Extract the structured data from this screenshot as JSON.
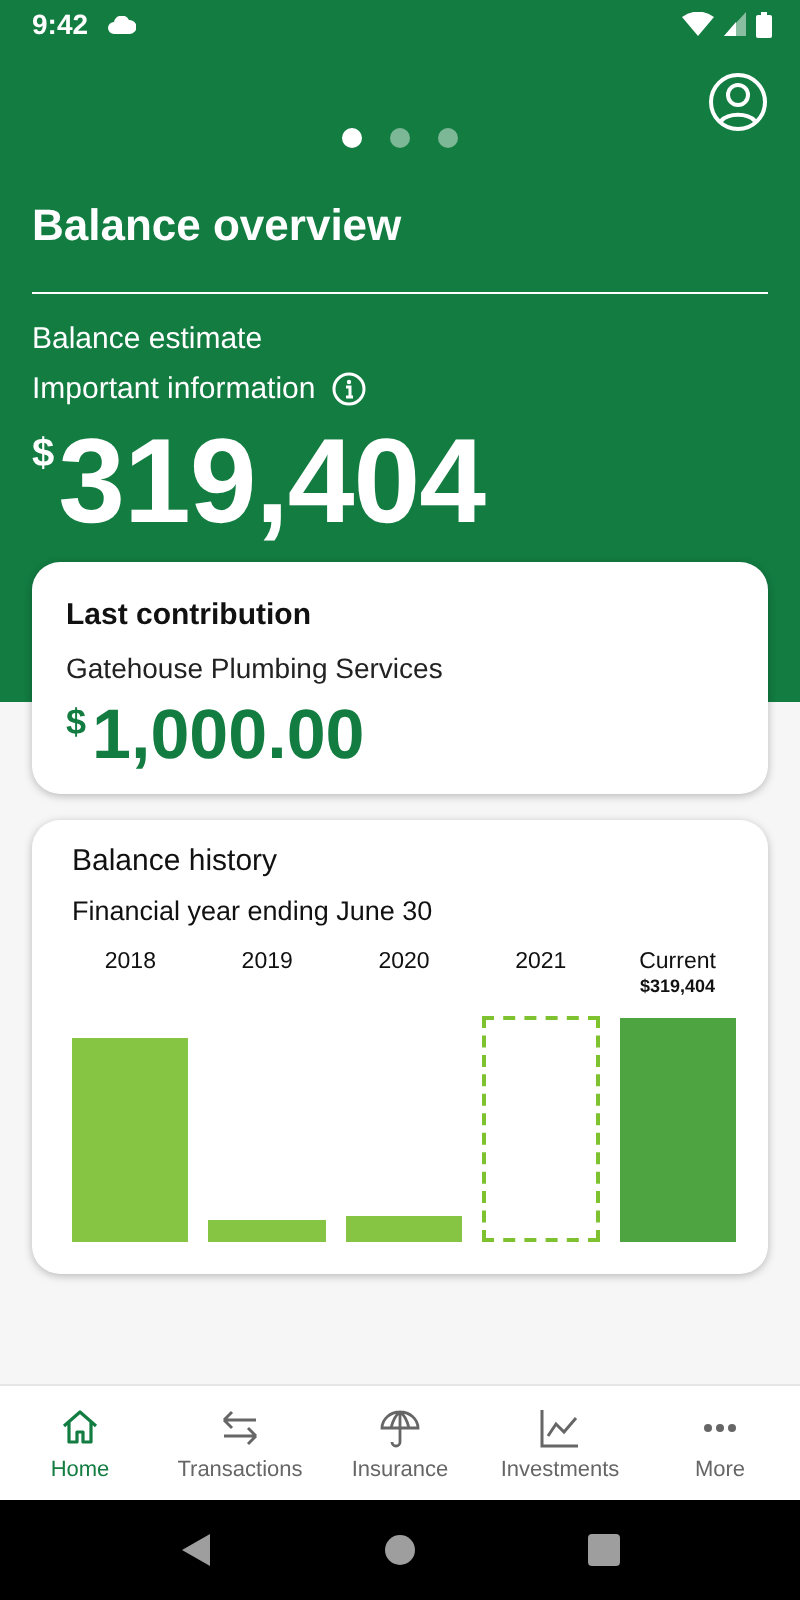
{
  "status_bar": {
    "time": "9:42"
  },
  "carousel": {
    "pages": [
      {
        "selected": true
      },
      {
        "selected": false
      },
      {
        "selected": false
      }
    ]
  },
  "header": {
    "title": "Balance overview",
    "subtitle": "Balance estimate",
    "info_link": "Important information",
    "currency": "$",
    "amount": "319,404"
  },
  "last_contribution": {
    "title": "Last contribution",
    "payer": "Gatehouse Plumbing Services",
    "currency": "$",
    "amount": "1,000.00"
  },
  "balance_history": {
    "title": "Balance history",
    "subtitle": "Financial year ending June 30",
    "bars": [
      {
        "label": "2018",
        "kind": "past"
      },
      {
        "label": "2019",
        "kind": "past"
      },
      {
        "label": "2020",
        "kind": "past"
      },
      {
        "label": "2021",
        "kind": "pending"
      },
      {
        "label": "Current",
        "value": "$319,404",
        "kind": "current"
      }
    ]
  },
  "bottom_nav": [
    {
      "label": "Home",
      "selected": true
    },
    {
      "label": "Transactions",
      "selected": false
    },
    {
      "label": "Insurance",
      "selected": false
    },
    {
      "label": "Investments",
      "selected": false
    },
    {
      "label": "More",
      "selected": false
    }
  ]
}
